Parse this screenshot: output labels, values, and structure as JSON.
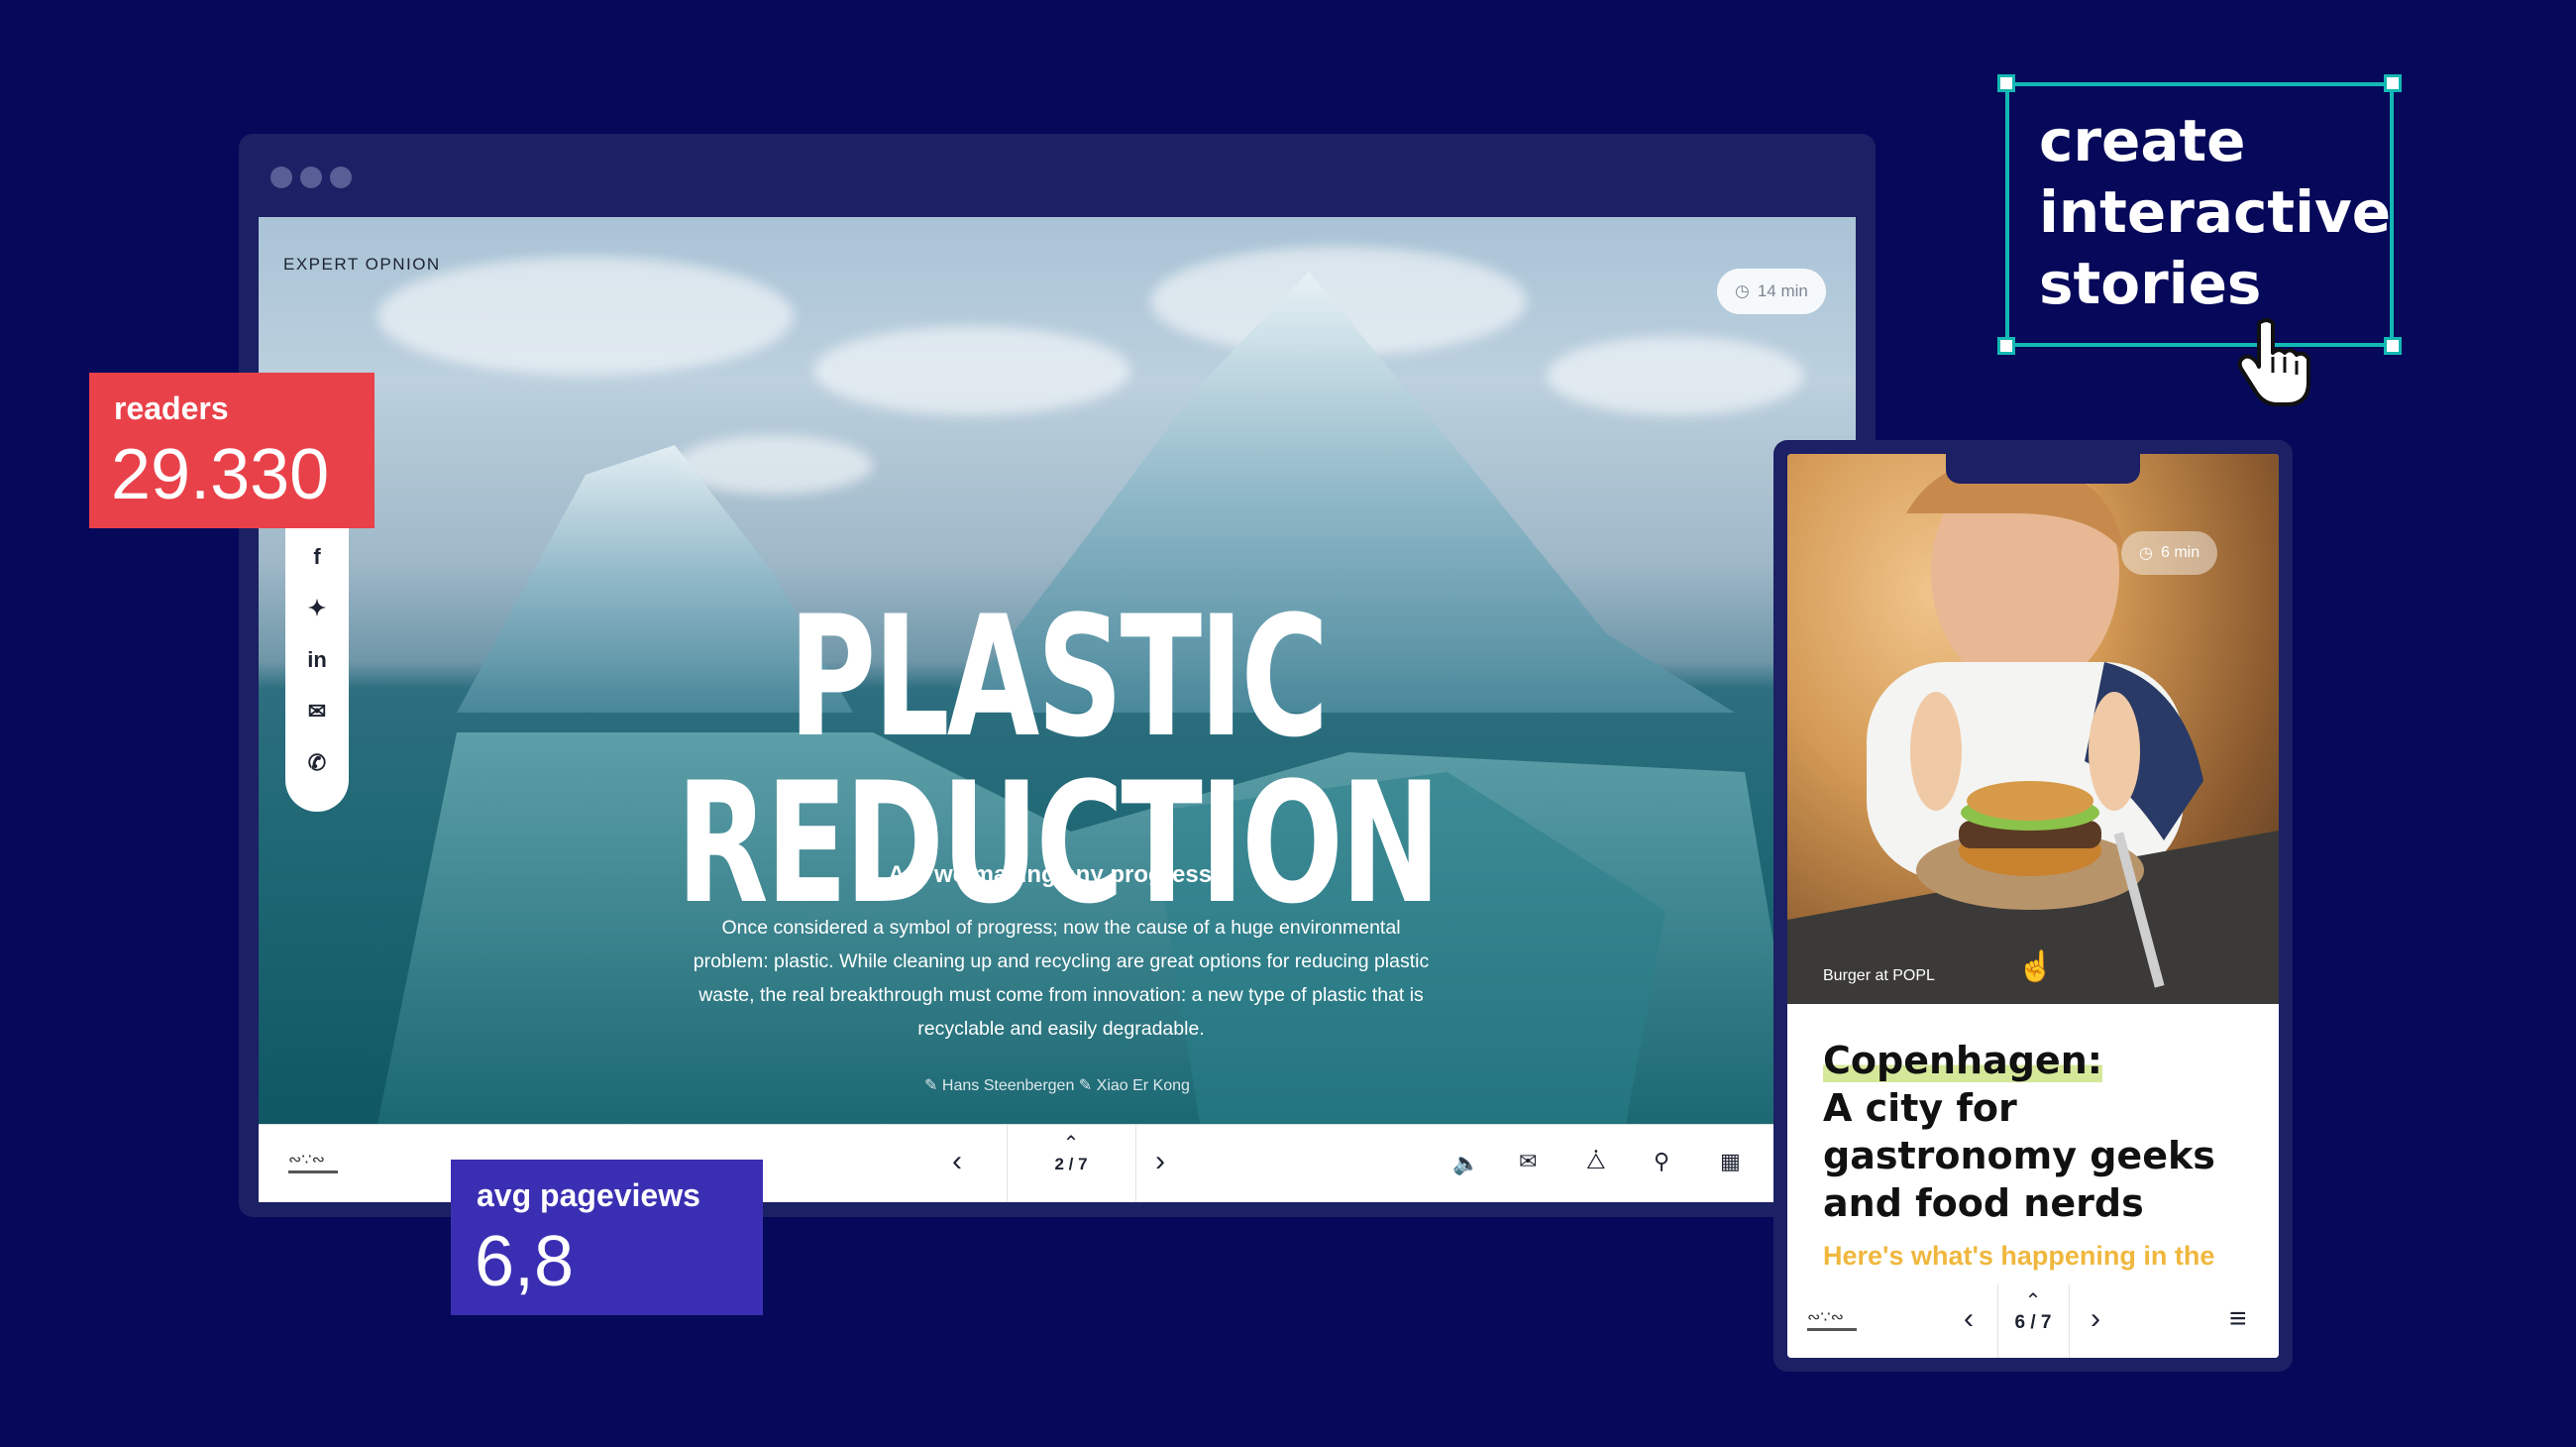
{
  "desktop": {
    "kicker": "EXPERT OPNION",
    "read_time": "14 min",
    "title": "PLASTIC REDUCTION",
    "subhead": "Are we making any progress?",
    "body": "Once considered a symbol of progress; now the cause of a huge environmental problem: plastic. While cleaning up and recycling are great options for reducing plastic waste, the real breakthrough must come from innovation: a new type of plastic that is recyclable and easily degradable.",
    "authors": [
      "Hans Steenbergen",
      "Xiao Er Kong"
    ],
    "page_indicator": "2 / 7",
    "social": [
      "facebook",
      "twitter",
      "linkedin",
      "email",
      "whatsapp"
    ],
    "toolbar_icons": [
      "sound-icon",
      "mail-icon",
      "share-icon",
      "search-icon",
      "grid-icon"
    ]
  },
  "stats": {
    "readers_label": "readers",
    "readers_value": "29.330",
    "pageviews_label": "avg pageviews",
    "pageviews_value": "6,8"
  },
  "promo": {
    "lines": [
      "create",
      "interactive",
      "stories"
    ]
  },
  "mobile": {
    "read_time": "6 min",
    "caption": "Burger at POPL",
    "title_highlight": "Copenhagen:",
    "title_rest": "A city for gastronomy geeks and food nerds",
    "lead": "Here's what's happening in the",
    "page_indicator": "6 / 7"
  },
  "colors": {
    "background": "#06085a",
    "frame": "#1c2064",
    "readers": "#e94149",
    "pageviews": "#3a2fb2",
    "accent": "#14b8b3",
    "lead": "#f0b73e",
    "highlight": "#d5e89a"
  }
}
